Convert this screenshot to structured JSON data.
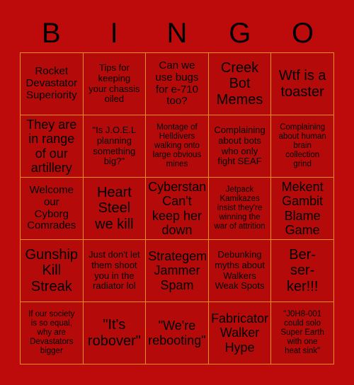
{
  "card": {
    "title": "BINGO",
    "header_letters": [
      "B",
      "I",
      "N",
      "G",
      "O"
    ],
    "background_color": "#bd0b0b",
    "cell_background_color": "#b40a0a",
    "border_color": "#e8901b",
    "text_color": "#000000",
    "columns": 5,
    "rows": 5,
    "cells": [
      {
        "row": 1,
        "col": 1,
        "column_letter": "B",
        "text": "Rocket\nDevastator\nSuperiority",
        "size": "md",
        "marked": false
      },
      {
        "row": 1,
        "col": 2,
        "column_letter": "I",
        "text": "Tips for\nkeeping\nyour chassis\noiled",
        "size": "sm",
        "marked": false
      },
      {
        "row": 1,
        "col": 3,
        "column_letter": "N",
        "text": "Can we\nuse bugs\nfor e-710\ntoo?",
        "size": "md",
        "marked": false
      },
      {
        "row": 1,
        "col": 4,
        "column_letter": "G",
        "text": "Creek\nBot\nMemes",
        "size": "xl",
        "marked": false
      },
      {
        "row": 1,
        "col": 5,
        "column_letter": "O",
        "text": "Wtf is a\ntoaster",
        "size": "xl",
        "marked": false
      },
      {
        "row": 2,
        "col": 1,
        "column_letter": "B",
        "text": "They are\nin range\nof our\nartillery",
        "size": "lg",
        "marked": false
      },
      {
        "row": 2,
        "col": 2,
        "column_letter": "I",
        "text": "\"Is J.O.E.L\nplanning\nsomething\nbig?\"",
        "size": "sm",
        "marked": false
      },
      {
        "row": 2,
        "col": 3,
        "column_letter": "N",
        "text": "Montage of\nHelldivers\nwalking onto\nlarge obvious\nmines",
        "size": "xs",
        "marked": false
      },
      {
        "row": 2,
        "col": 4,
        "column_letter": "G",
        "text": "Complaining\nabout bots\nwho only\nfight SEAF",
        "size": "sm",
        "marked": false
      },
      {
        "row": 2,
        "col": 5,
        "column_letter": "O",
        "text": "Complaining\nabout human\nbrain\ncollection\ngrind",
        "size": "xs",
        "marked": false
      },
      {
        "row": 3,
        "col": 1,
        "column_letter": "B",
        "text": "Welcome\nour\nCyborg\nComrades",
        "size": "md",
        "marked": false
      },
      {
        "row": 3,
        "col": 2,
        "column_letter": "I",
        "text": "Heart\nSteel\nwe kill",
        "size": "xl",
        "marked": false
      },
      {
        "row": 3,
        "col": 3,
        "column_letter": "N",
        "text": "Cyberstan\nCan't\nkeep her\ndown",
        "size": "lg",
        "marked": false
      },
      {
        "row": 3,
        "col": 4,
        "column_letter": "G",
        "text": "Jetpack\nKamikazes\ninsist they're\nwinning the\nwar of attrition",
        "size": "xs",
        "marked": false
      },
      {
        "row": 3,
        "col": 5,
        "column_letter": "O",
        "text": "Mekent\nGambit\nBlame\nGame",
        "size": "lg",
        "marked": false
      },
      {
        "row": 4,
        "col": 1,
        "column_letter": "B",
        "text": "Gunship\nKill\nStreak",
        "size": "xl",
        "marked": false
      },
      {
        "row": 4,
        "col": 2,
        "column_letter": "I",
        "text": "Just don't let\nthem shoot\nyou in the\nradiator lol",
        "size": "sm",
        "marked": false
      },
      {
        "row": 4,
        "col": 3,
        "column_letter": "N",
        "text": "Strategem\nJammer\nSpam",
        "size": "lg",
        "marked": false
      },
      {
        "row": 4,
        "col": 4,
        "column_letter": "G",
        "text": "Debunking\nmyths about\nWalkers\nWeak Spots",
        "size": "sm",
        "marked": false
      },
      {
        "row": 4,
        "col": 5,
        "column_letter": "O",
        "text": "Ber-\nser-\nker!!!",
        "size": "xl",
        "marked": false
      },
      {
        "row": 5,
        "col": 1,
        "column_letter": "B",
        "text": "If our society\nis so equal,\nwhy are\nDevastators\nbigger",
        "size": "xs",
        "marked": false
      },
      {
        "row": 5,
        "col": 2,
        "column_letter": "I",
        "text": "\"It's\nrobover\"",
        "size": "xl",
        "marked": false
      },
      {
        "row": 5,
        "col": 3,
        "column_letter": "N",
        "text": "\"We're\nrebooting\"",
        "size": "lg",
        "marked": false
      },
      {
        "row": 5,
        "col": 4,
        "column_letter": "G",
        "text": "Fabricator\nWalker\nHype",
        "size": "lg",
        "marked": false
      },
      {
        "row": 5,
        "col": 5,
        "column_letter": "O",
        "text": "\"J0H8-001\ncould solo\nSuper Earth\nwith one\nheat sink\"",
        "size": "xs",
        "marked": false
      }
    ]
  }
}
